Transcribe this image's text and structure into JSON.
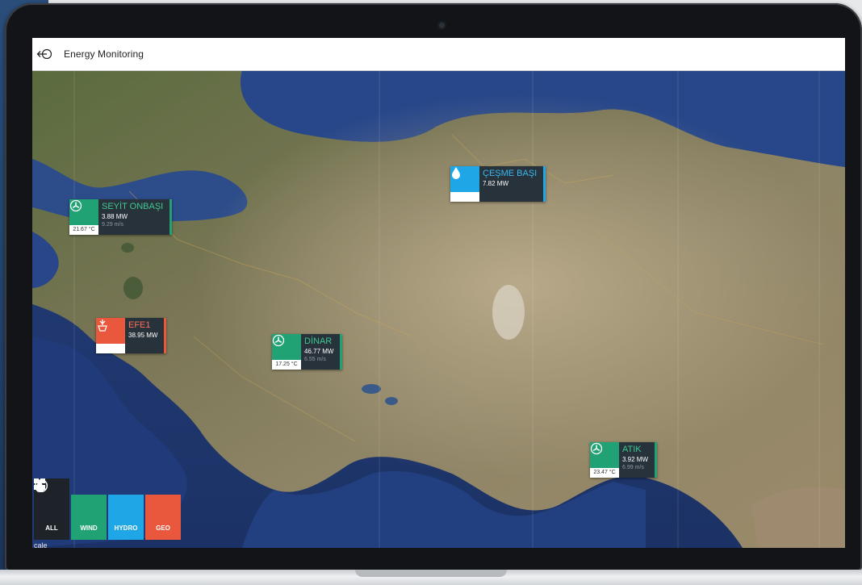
{
  "app": {
    "title": "Energy Monitoring"
  },
  "map": {
    "scale_label": "cale"
  },
  "sites": [
    {
      "type": "wind",
      "name": "SEYİT ONBAŞI",
      "power": "3.88 MW",
      "wind_speed": "9.29 m/s",
      "temperature": "21.67 °C"
    },
    {
      "type": "hydro",
      "name": "ÇEŞME BAŞI",
      "power": "7.82 MW",
      "wind_speed": "",
      "temperature": ""
    },
    {
      "type": "geo",
      "name": "EFE1",
      "power": "38.95 MW",
      "wind_speed": "",
      "temperature": ""
    },
    {
      "type": "wind",
      "name": "DİNAR",
      "power": "46.77 MW",
      "wind_speed": "6.55 m/s",
      "temperature": "17.25 °C"
    },
    {
      "type": "wind",
      "name": "ATIK",
      "power": "3.92 MW",
      "wind_speed": "6.99 m/s",
      "temperature": "23.47 °C"
    }
  ],
  "filters": {
    "all": "ALL",
    "wind": "WIND",
    "hydro": "HYDRO",
    "geo": "GEO"
  },
  "colors": {
    "wind": "#21a274",
    "hydro": "#1ea6e6",
    "geo": "#e9573d",
    "panel": "#28323b"
  }
}
